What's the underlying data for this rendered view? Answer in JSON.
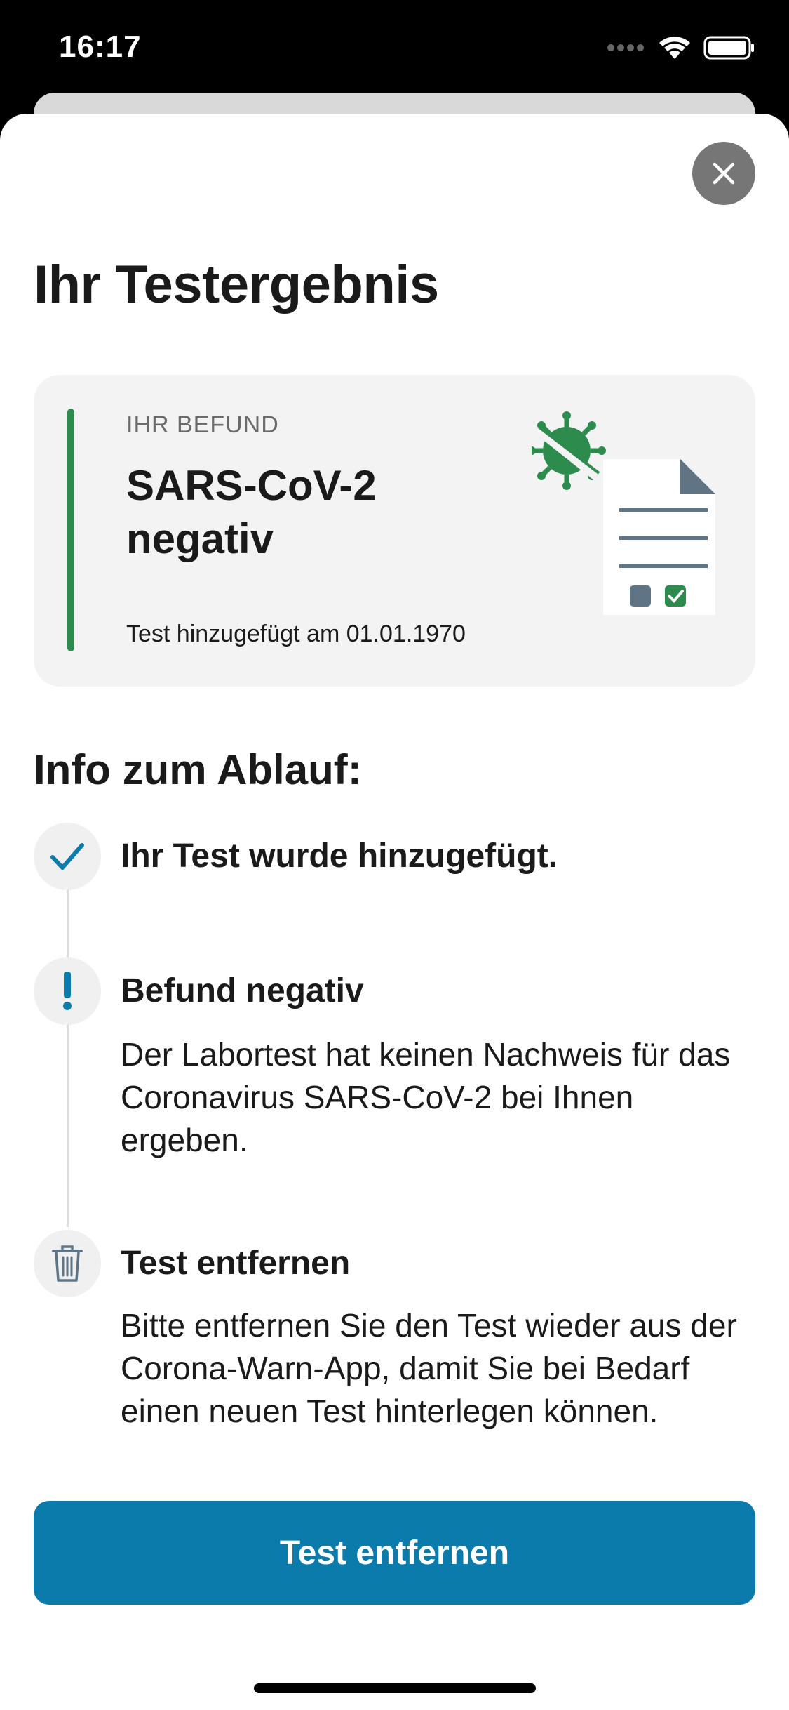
{
  "status_bar": {
    "time": "16:17"
  },
  "header": {
    "title": "Ihr Testergebnis"
  },
  "result_card": {
    "label": "IHR BEFUND",
    "value": "SARS-CoV-2 negativ",
    "date_text": "Test hinzugefügt am 01.01.1970",
    "accent_color": "#2e8b4e"
  },
  "info": {
    "title": "Info zum Ablauf:",
    "steps": [
      {
        "icon": "checkmark-icon",
        "title": "Ihr Test wurde hinzugefügt.",
        "text": ""
      },
      {
        "icon": "exclamation-icon",
        "title": "Befund negativ",
        "text": "Der Labortest hat keinen Nachweis für das Coronavirus SARS-CoV-2 bei Ihnen ergeben."
      },
      {
        "icon": "trash-icon",
        "title": "Test entfernen",
        "text": "Bitte entfernen Sie den Test wieder aus der Corona-Warn-App, damit Sie bei Bedarf einen neuen Test hinterlegen können."
      }
    ]
  },
  "actions": {
    "primary_label": "Test entfernen",
    "primary_color": "#0b7bab"
  }
}
